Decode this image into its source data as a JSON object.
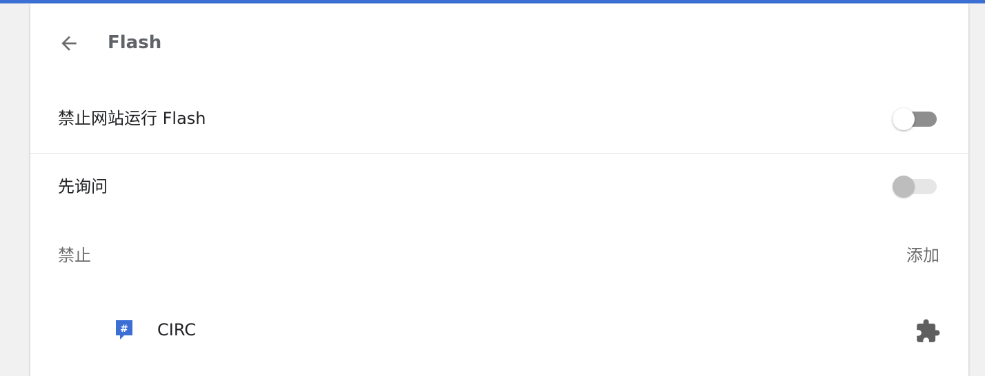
{
  "header": {
    "title": "Flash",
    "back_icon": "arrow-back-icon"
  },
  "settings": {
    "block_flash": {
      "label": "禁止网站运行 Flash",
      "enabled": false
    },
    "ask_first": {
      "label": "先询问",
      "enabled": false,
      "disabled": true
    }
  },
  "block_section": {
    "title": "禁止",
    "add_label": "添加",
    "sites": [
      {
        "name": "CIRC",
        "icon": "circ-app-icon",
        "source_icon": "extension-puzzle-icon"
      }
    ]
  },
  "colors": {
    "accent_bar": "#3b6fd4",
    "circ_icon": "#3b6fd4"
  }
}
